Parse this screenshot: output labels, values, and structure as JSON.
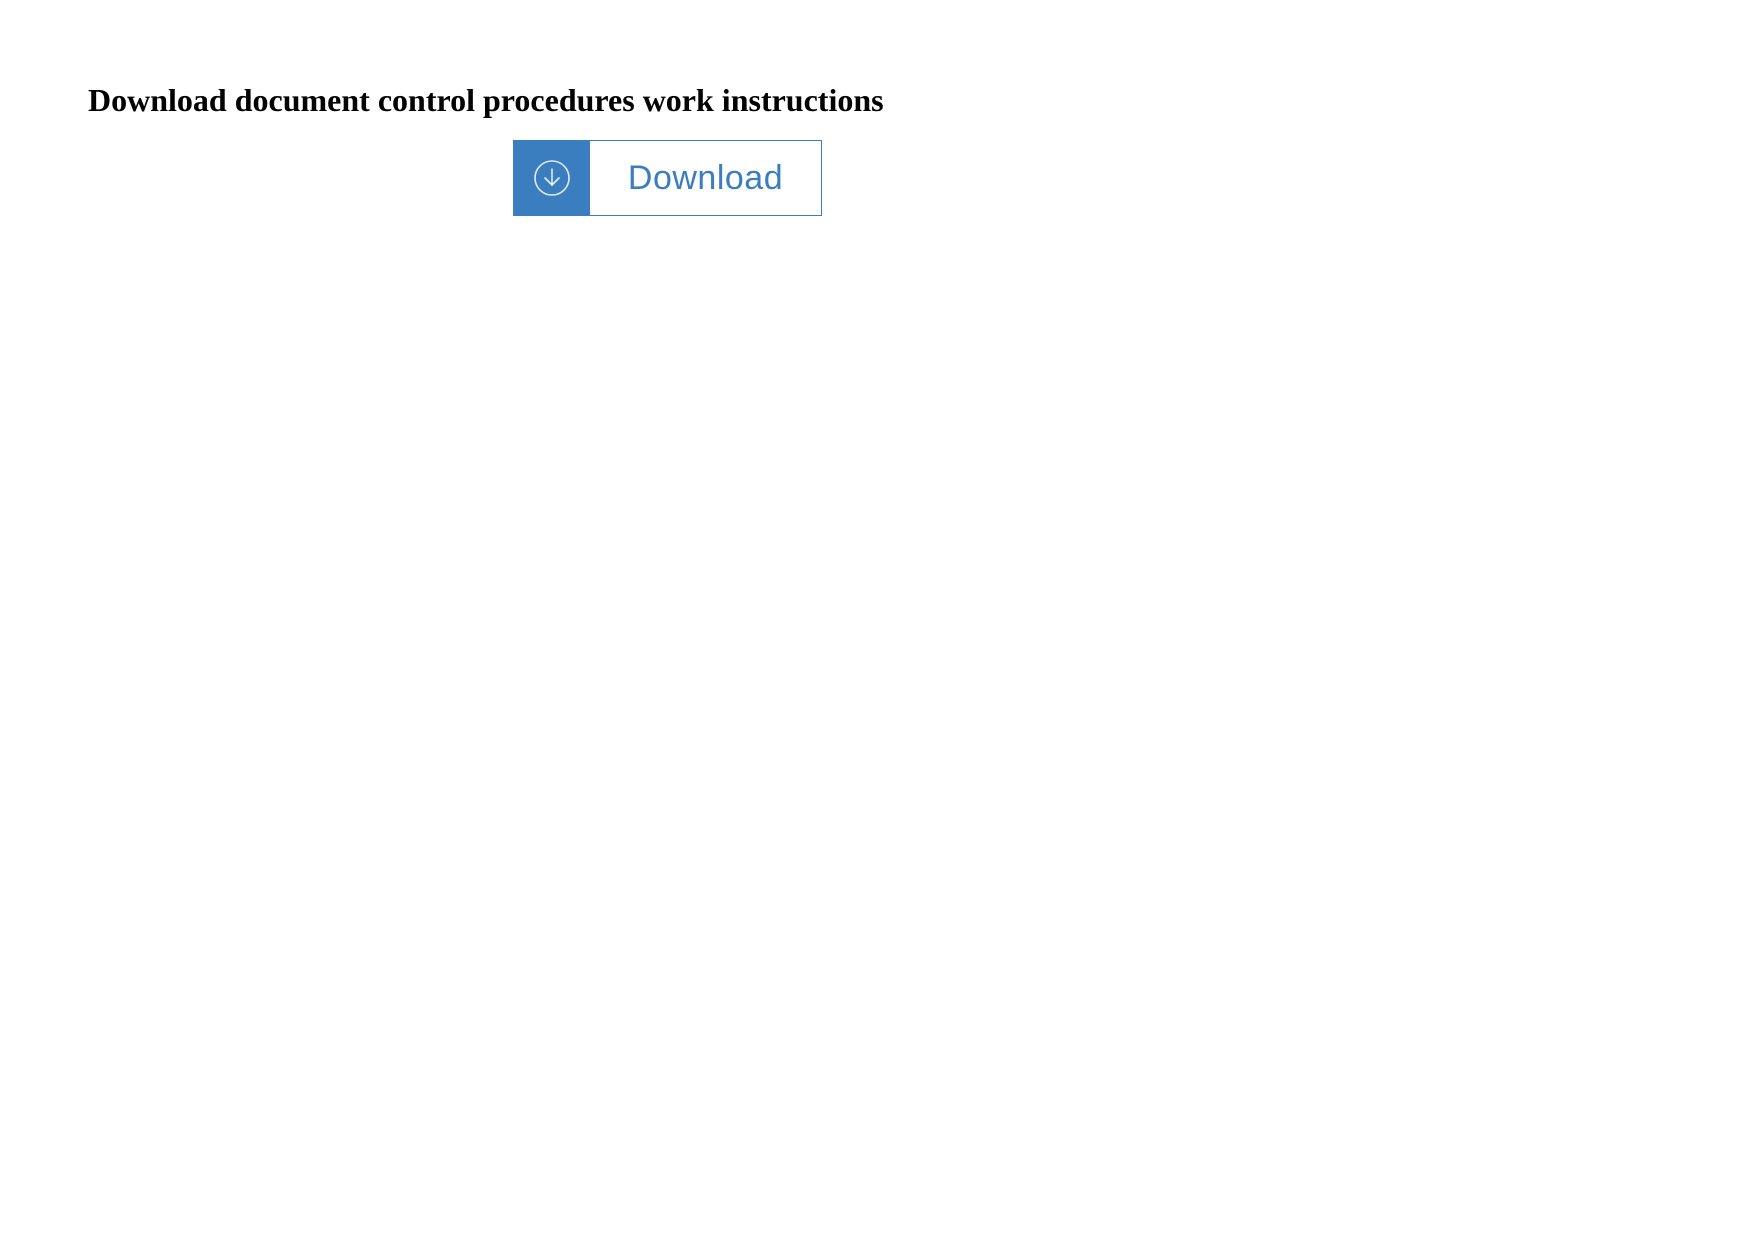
{
  "page": {
    "title": "Download document control procedures work instructions"
  },
  "button": {
    "label": "Download",
    "icon": "download-arrow-circle-icon"
  },
  "colors": {
    "accent": "#3b7ec0",
    "text": "#000000",
    "background": "#ffffff"
  }
}
